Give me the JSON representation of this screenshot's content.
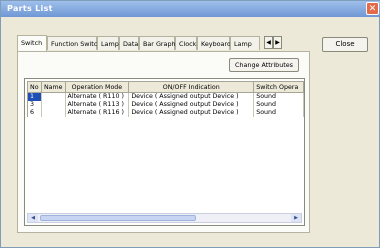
{
  "window": {
    "title": "Parts List"
  },
  "tabs": [
    "Switch",
    "Function Switch",
    "Lamp",
    "Data",
    "Bar Graph",
    "Clock",
    "Keyboard",
    "Lamp"
  ],
  "active_tab": "Switch",
  "tab_scroll": {
    "left": "◀",
    "right": "▶"
  },
  "buttons": {
    "change_attributes": "Change Attributes",
    "close": "Close"
  },
  "table": {
    "columns": [
      "No",
      "Name",
      "Operation Mode",
      "ON/OFF Indication",
      "Switch Opera"
    ],
    "rows": [
      {
        "no": "1",
        "name": "",
        "mode": "Alternate ( R110 )",
        "indication": "Device ( Assigned output Device )",
        "switch_op": "Sound"
      },
      {
        "no": "3",
        "name": "",
        "mode": "Alternate ( R113 )",
        "indication": "Device ( Assigned output Device )",
        "switch_op": "Sound"
      },
      {
        "no": "6",
        "name": "",
        "mode": "Alternate ( R116 )",
        "indication": "Device ( Assigned output Device )",
        "switch_op": "Sound"
      }
    ],
    "selected_row": 0
  },
  "colors": {
    "title_bar": "#7fa6e0",
    "selection": "#1f4fb4",
    "close_button": "#e26b4a"
  }
}
